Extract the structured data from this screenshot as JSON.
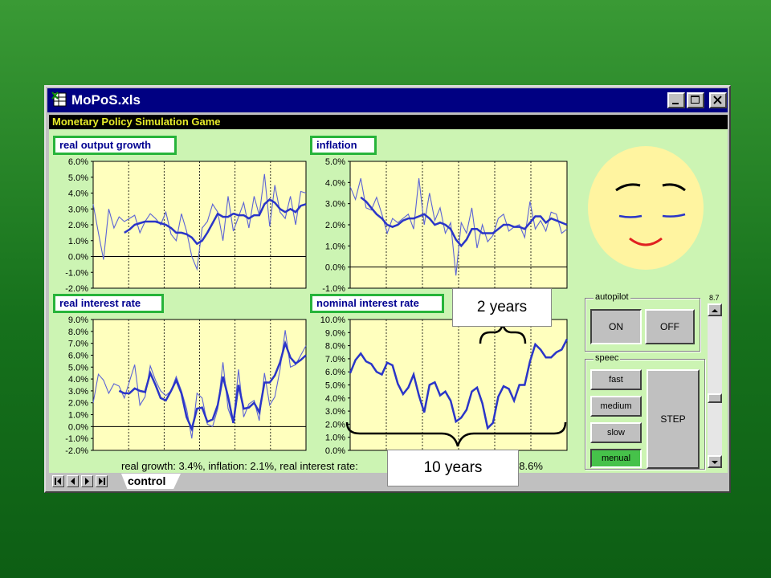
{
  "window": {
    "title": "MoPoS.xls"
  },
  "sheet": {
    "title": "Monetary Policy Simulation Game"
  },
  "charts": [
    {
      "id": "growth",
      "title": "real output growth",
      "ymin": -2,
      "ymax": 6,
      "step": 1,
      "dec": 1,
      "ticks": [
        "6.0%",
        "5.0%",
        "4.0%",
        "3.0%",
        "2.0%",
        "1.0%",
        "0.0%",
        "-1.0%",
        "-2.0%"
      ],
      "actual": [
        3.3,
        1.5,
        -0.2,
        3.0,
        1.8,
        2.5,
        2.2,
        2.4,
        2.6,
        1.5,
        2.2,
        2.7,
        2.4,
        2.0,
        2.8,
        1.4,
        1.0,
        2.7,
        1.6,
        0.0,
        -0.8,
        1.8,
        2.2,
        3.3,
        2.8,
        1.0,
        3.8,
        1.6,
        2.5,
        3.4,
        1.8,
        3.8,
        2.6,
        5.2,
        1.9,
        4.5,
        2.8,
        2.4,
        3.8,
        2.0,
        4.1,
        4.0
      ],
      "trend": [
        null,
        null,
        null,
        null,
        null,
        null,
        1.5,
        1.7,
        2.0,
        2.1,
        2.2,
        2.2,
        2.2,
        2.1,
        2.0,
        1.8,
        1.5,
        1.5,
        1.4,
        1.2,
        0.8,
        1.0,
        1.5,
        2.1,
        2.7,
        2.5,
        2.5,
        2.7,
        2.6,
        2.6,
        2.4,
        2.6,
        2.6,
        3.3,
        3.6,
        3.4,
        3.0,
        2.8,
        3.0,
        2.8,
        3.2,
        3.3
      ]
    },
    {
      "id": "inflation",
      "title": "inflation",
      "ymin": -1,
      "ymax": 5,
      "step": 1,
      "dec": 1,
      "ticks": [
        "5.0%",
        "4.0%",
        "3.0%",
        "2.0%",
        "1.0%",
        "0.0%",
        "-1.0%"
      ],
      "actual": [
        3.8,
        3.2,
        4.2,
        2.8,
        2.7,
        3.3,
        2.5,
        1.6,
        2.3,
        2.1,
        2.3,
        2.5,
        1.8,
        4.2,
        2.0,
        3.5,
        2.2,
        2.8,
        1.6,
        2.1,
        -0.4,
        2.1,
        1.6,
        2.8,
        0.9,
        2.0,
        1.2,
        1.5,
        2.3,
        2.5,
        1.7,
        1.9,
        2.0,
        1.4,
        3.1,
        1.8,
        2.2,
        1.7,
        2.6,
        2.5,
        1.6,
        1.8
      ],
      "trend": [
        null,
        null,
        3.3,
        3.1,
        2.8,
        2.5,
        2.3,
        2.0,
        1.9,
        2.0,
        2.2,
        2.3,
        2.3,
        2.4,
        2.5,
        2.3,
        2.0,
        2.1,
        2.0,
        1.8,
        1.3,
        1.0,
        1.3,
        1.8,
        1.8,
        1.6,
        1.6,
        1.6,
        1.8,
        2.0,
        2.0,
        1.9,
        1.9,
        1.8,
        2.1,
        2.4,
        2.4,
        2.1,
        2.3,
        2.2,
        2.1,
        2.0
      ]
    },
    {
      "id": "realrate",
      "title": "real interest rate",
      "ymin": -2,
      "ymax": 9,
      "step": 1,
      "dec": 1,
      "ticks": [
        "9.0%",
        "8.0%",
        "7.0%",
        "6.0%",
        "5.0%",
        "4.0%",
        "3.0%",
        "2.0%",
        "1.0%",
        "0.0%",
        "-1.0%",
        "-2.0%"
      ],
      "actual": [
        2.0,
        4.4,
        3.9,
        2.8,
        3.6,
        3.4,
        2.4,
        3.8,
        5.2,
        1.8,
        2.5,
        5.1,
        3.9,
        3.0,
        2.6,
        3.0,
        4.2,
        3.0,
        1.5,
        -1.0,
        2.8,
        2.4,
        0.2,
        0.0,
        1.5,
        5.4,
        1.5,
        0.3,
        4.8,
        0.8,
        1.9,
        2.2,
        0.5,
        4.5,
        1.8,
        2.5,
        4.8,
        8.1,
        5.0,
        5.2,
        6.0,
        6.8
      ],
      "trend": [
        null,
        null,
        null,
        null,
        null,
        3.0,
        2.8,
        2.8,
        3.2,
        3.0,
        2.9,
        4.5,
        3.5,
        2.4,
        2.2,
        3.0,
        3.9,
        2.8,
        0.8,
        -0.2,
        1.5,
        1.6,
        0.4,
        0.6,
        1.8,
        4.2,
        2.5,
        0.3,
        3.5,
        1.5,
        1.6,
        2.0,
        1.2,
        3.7,
        3.7,
        4.3,
        5.4,
        7.0,
        5.8,
        5.3,
        5.6,
        6.0
      ]
    },
    {
      "id": "nominal",
      "title": "nominal interest rate",
      "ymin": 0,
      "ymax": 10,
      "step": 1,
      "dec": 1,
      "ticks": [
        "10.0%",
        "9.0%",
        "8.0%",
        "7.0%",
        "6.0%",
        "5.0%",
        "4.0%",
        "3.0%",
        "2.0%",
        "1.0%",
        "0.0%"
      ],
      "actual": [
        5.9,
        6.9,
        7.4,
        6.8,
        6.6,
        6.0,
        5.8,
        6.7,
        6.5,
        5.1,
        4.3,
        4.8,
        5.8,
        4.2,
        2.9,
        5.0,
        5.2,
        4.2,
        4.5,
        3.8,
        2.2,
        2.5,
        3.1,
        4.5,
        4.8,
        3.6,
        1.7,
        2.1,
        4.1,
        4.9,
        4.7,
        3.8,
        5.0,
        5.0,
        6.8,
        8.1,
        7.7,
        7.1,
        7.1,
        7.5,
        7.7,
        8.5
      ],
      "trend": []
    }
  ],
  "face": {
    "mood": "happy"
  },
  "autopilot": {
    "caption": "autopilot",
    "on": "ON",
    "off": "OFF"
  },
  "speed": {
    "caption": "speec",
    "fast": "fast",
    "medium": "medium",
    "slow": "slow",
    "manual": "menual",
    "step": "STEP"
  },
  "scroll": {
    "value": "8.7"
  },
  "status": {
    "text": "real growth: 3.4%, inflation: 2.1%, real interest rate:",
    "tail": "ate: 8.6%"
  },
  "tabs": {
    "active": "control"
  },
  "callouts": {
    "two_years": "2 years",
    "ten_years": "10 years"
  },
  "colors": {
    "titlebar": "#000082",
    "sheet_bg": "#ccf4b3",
    "plot_bg": "#ffffbe",
    "line": "#2a35c8",
    "label_border": "#27b43a"
  }
}
